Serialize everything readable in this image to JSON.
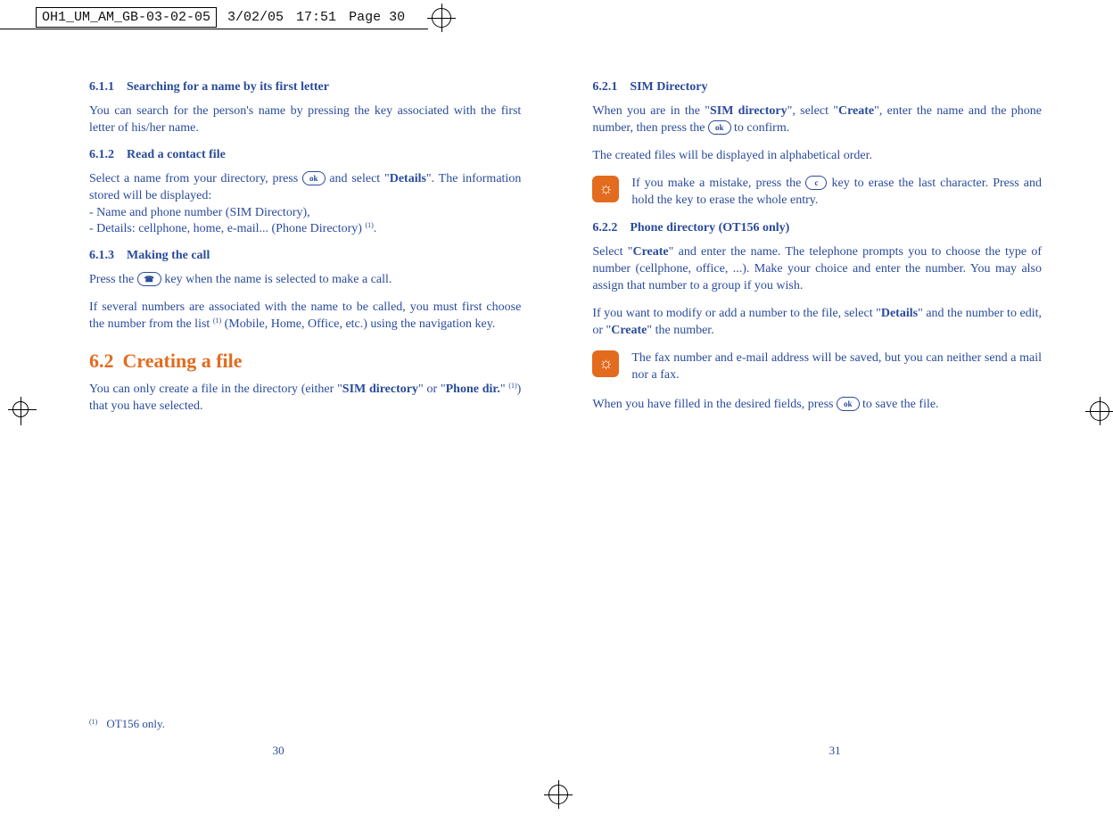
{
  "crop": {
    "filename": "OH1_UM_AM_GB-03-02-05",
    "date": "3/02/05",
    "time": "17:51",
    "pagemark": "Page 30"
  },
  "left": {
    "s611_num": "6.1.1",
    "s611_title": "Searching for a name by its first letter",
    "s611_body": "You can search for the person's name by pressing the key associated with the first letter of his/her name.",
    "s612_num": "6.1.2",
    "s612_title": "Read a contact file",
    "s612_body_a": "Select a name from your directory, press ",
    "s612_body_b": " and select \"",
    "s612_bold1": "Details",
    "s612_body_c": "\". The information stored will be displayed:",
    "s612_li1": "- Name and phone number (SIM Directory),",
    "s612_li2": "- Details: cellphone, home, e-mail... (Phone Directory) ",
    "s612_li2_end": ".",
    "s613_num": "6.1.3",
    "s613_title": "Making the call",
    "s613_body1_a": "Press the ",
    "s613_body1_b": " key when the name is selected to make a call.",
    "s613_body2_a": "If several numbers are associated with the name to be called, you must first choose the number from the list ",
    "s613_body2_b": " (Mobile, Home, Office, etc.) using the navigation key.",
    "s62_num": "6.2",
    "s62_title": "Creating a file",
    "s62_body_a": "You can only create a file in the directory (either \"",
    "s62_bold1": "SIM directory",
    "s62_body_b": "\" or \"",
    "s62_bold2": "Phone dir.",
    "s62_body_c": "\" ",
    "s62_body_d": ") that you have selected.",
    "footnote_sup": "(1)",
    "footnote_text": "OT156 only.",
    "page_num": "30"
  },
  "right": {
    "s621_num": "6.2.1",
    "s621_title": "SIM Directory",
    "s621_body1_a": "When you are in the \"",
    "s621_bold1": "SIM directory",
    "s621_body1_b": "\", select \"",
    "s621_bold2": "Create",
    "s621_body1_c": "\", enter the name and the phone number, then press the ",
    "s621_body1_d": " to confirm.",
    "s621_body2": "The created files will be displayed in alphabetical order.",
    "tip1_a": "If you make a mistake, press the ",
    "tip1_b": " key to erase the last character. Press and hold the key to erase the whole entry.",
    "s622_num": "6.2.2",
    "s622_title": "Phone directory (OT156 only)",
    "s622_body1_a": "Select \"",
    "s622_bold1": "Create",
    "s622_body1_b": "\" and enter the name. The telephone prompts you to choose the type of number (cellphone, office, ...). Make your choice and enter the number. You may also assign that number to a group if you wish.",
    "s622_body2_a": "If you want to modify or add a number to the file, select \"",
    "s622_bold2": "Details",
    "s622_body2_b": "\" and the number to edit, or \"",
    "s622_bold3": "Create",
    "s622_body2_c": "\" the number.",
    "tip2": "The fax number and e-mail address will be saved, but you can neither send a mail nor a fax.",
    "s622_body3_a": "When you have filled in the desired fields, press ",
    "s622_body3_b": " to save the file.",
    "page_num": "31"
  },
  "keys": {
    "ok": "ok",
    "c": "c",
    "call": ""
  },
  "sup1": "(1)"
}
